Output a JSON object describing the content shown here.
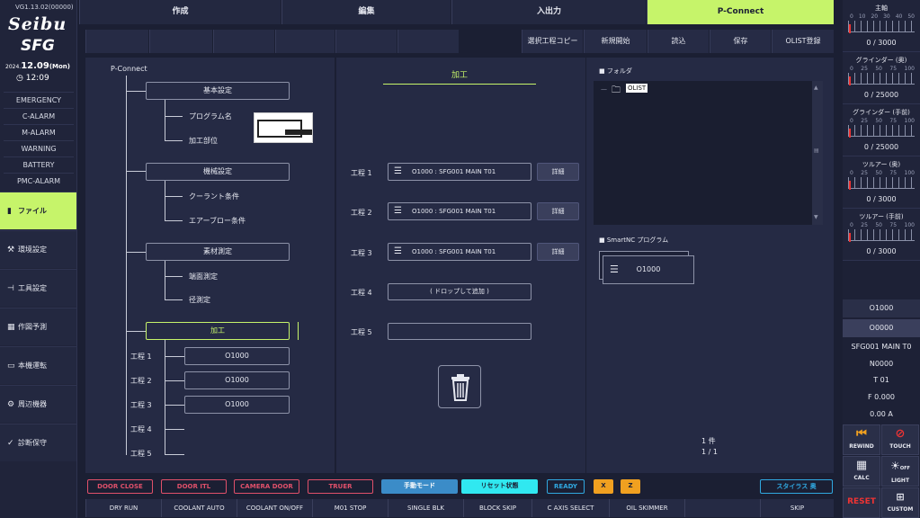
{
  "left": {
    "version": "VG1.13.02(00000)",
    "logo1": "Seibu",
    "logo2": "SFG",
    "date_small": "2024.",
    "date_big": "12.09",
    "date_dow": "(Mon)",
    "time": "12:09",
    "alarms": [
      "EMERGENCY",
      "C-ALARM",
      "M-ALARM",
      "WARNING",
      "BATTERY",
      "PMC-ALARM"
    ],
    "nav": [
      {
        "label": "ファイル",
        "icon": "file-icon",
        "glyph": "▮"
      },
      {
        "label": "環境設定",
        "icon": "wrench-icon",
        "glyph": "⚒"
      },
      {
        "label": "工具設定",
        "icon": "tool-icon",
        "glyph": "⊣"
      },
      {
        "label": "作図予測",
        "icon": "calendar-icon",
        "glyph": "▦"
      },
      {
        "label": "本機運転",
        "icon": "monitor-icon",
        "glyph": "▭"
      },
      {
        "label": "周辺機器",
        "icon": "gear-icon",
        "glyph": "⚙"
      },
      {
        "label": "診断保守",
        "icon": "check-icon",
        "glyph": "✓"
      }
    ]
  },
  "tabs": [
    "作成",
    "編集",
    "入出力",
    "P-Connect"
  ],
  "subtabs": [
    "",
    "",
    "",
    "",
    "",
    "",
    "選択工程コピー",
    "新規開始",
    "読込",
    "保存",
    "OLIST登録"
  ],
  "tree": {
    "root": "P-Connect",
    "basic": "基本設定",
    "program_name": "プログラム名",
    "machining_part": "加工部位",
    "machine": "機械設定",
    "coolant": "クーラント条件",
    "airblow": "エアーブロー条件",
    "material": "素材測定",
    "end_face": "端面測定",
    "diameter": "径測定",
    "machining": "加工",
    "steps": [
      "工程 1",
      "工程 2",
      "工程 3",
      "工程 4",
      "工程 5"
    ],
    "step_programs": [
      "O1000",
      "O1000",
      "O1000"
    ]
  },
  "center": {
    "title": "加工",
    "steps": [
      {
        "label": "工程 1",
        "program": "O1000 : SFG001 MAIN T01",
        "detail": "詳細"
      },
      {
        "label": "工程 2",
        "program": "O1000 : SFG001 MAIN T01",
        "detail": "詳細"
      },
      {
        "label": "工程 3",
        "program": "O1000 : SFG001 MAIN T01",
        "detail": "詳細"
      },
      {
        "label": "工程 4",
        "program": "( ドロップして追加 )",
        "detail": ""
      },
      {
        "label": "工程 5",
        "program": "",
        "detail": ""
      }
    ]
  },
  "folder": {
    "title": "■ フォルダ",
    "item": "OLIST",
    "smartnc_title": "■ SmartNC プログラム",
    "smartnc_item": "O1000",
    "count": "1 件",
    "page": "1 / 1"
  },
  "gauges": [
    {
      "title": "主軸",
      "scale": [
        "0",
        "10",
        "20",
        "30",
        "40",
        "50"
      ],
      "value": "0 /   3000"
    },
    {
      "title": "グラインダー (奥)",
      "scale": [
        "0",
        "25",
        "50",
        "75",
        "100"
      ],
      "value": "0 / 25000"
    },
    {
      "title": "グラインダー (手前)",
      "scale": [
        "0",
        "25",
        "50",
        "75",
        "100"
      ],
      "value": "0 / 25000"
    },
    {
      "title": "ツルアー (奥)",
      "scale": [
        "0",
        "25",
        "50",
        "75",
        "100"
      ],
      "value": "0 /   3000"
    },
    {
      "title": "ツルアー (手前)",
      "scale": [
        "0",
        "25",
        "50",
        "75",
        "100"
      ],
      "value": "0 /   3000"
    }
  ],
  "rinfo": {
    "prog": "O1000",
    "seq": "O0000",
    "name": "SFG001 MAIN T0",
    "n": "N0000",
    "t": "T 01",
    "f": "F 0.000",
    "a": "0.00 A"
  },
  "rbtns": {
    "rewind": "REWIND",
    "touch": "TOUCH",
    "calc": "CALC",
    "light": "LIGHT",
    "light_state": "OFF",
    "custom": "CUSTOM",
    "red": "RESET"
  },
  "chips": [
    {
      "label": "DOOR CLOSE"
    },
    {
      "label": "DOOR ITL"
    },
    {
      "label": "CAMERA DOOR"
    },
    {
      "label": "TRUER"
    },
    {
      "label": "手動モード"
    },
    {
      "label": "リセット状態"
    },
    {
      "label": "READY"
    },
    {
      "label": "X"
    },
    {
      "label": "Z"
    },
    {
      "label": "スタイラス 奥"
    }
  ],
  "fkeys": [
    "DRY RUN",
    "COOLANT AUTO",
    "COOLANT ON/OFF",
    "M01 STOP",
    "SINGLE BLK",
    "BLOCK SKIP",
    "C AXIS SELECT",
    "OIL SKIMMER",
    "",
    "SKIP"
  ],
  "colors": {
    "accent": "#c6f46a",
    "chip_red": "#e0506a",
    "chip_blue": "#3b8cc8",
    "chip_cyan": "#30e8f0",
    "chip_orange": "#f0a020"
  }
}
